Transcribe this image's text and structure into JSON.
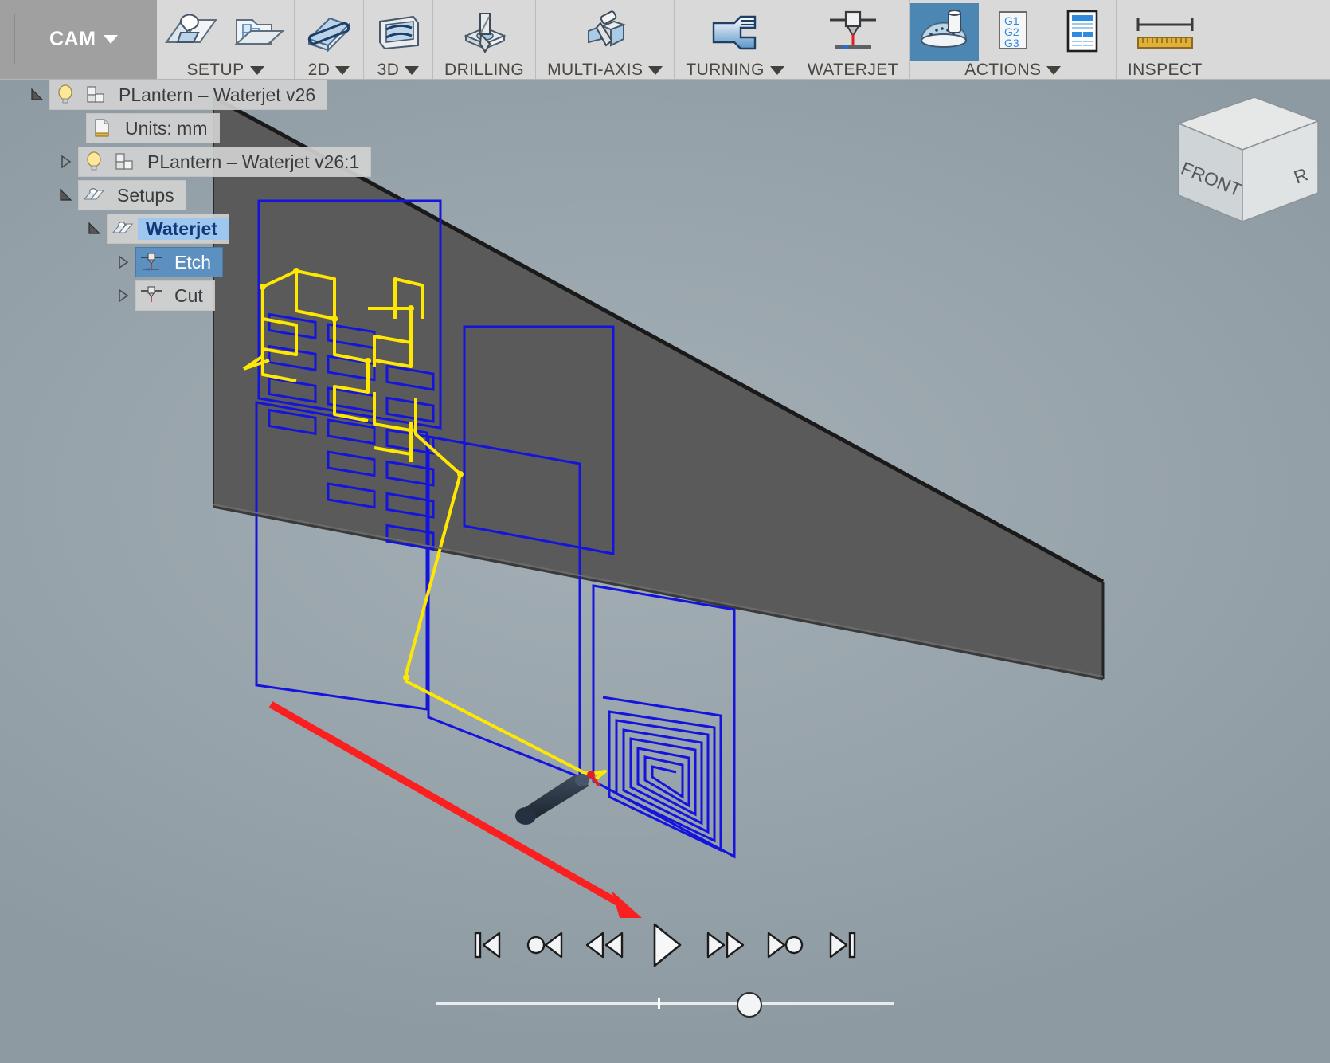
{
  "app": {
    "workspace_label": "CAM",
    "workspace_caret": "chevron-down-icon"
  },
  "ribbon": {
    "panels": [
      {
        "id": "setup",
        "label": "SETUP",
        "has_caret": true,
        "icons": [
          "new-setup-icon",
          "new-folder-icon"
        ]
      },
      {
        "id": "2d",
        "label": "2D",
        "has_caret": true,
        "icons": [
          "2d-milling-icon"
        ]
      },
      {
        "id": "3d",
        "label": "3D",
        "has_caret": true,
        "icons": [
          "3d-milling-icon"
        ]
      },
      {
        "id": "drilling",
        "label": "DRILLING",
        "has_caret": false,
        "icons": [
          "drilling-icon"
        ]
      },
      {
        "id": "multi-axis",
        "label": "MULTI-AXIS",
        "has_caret": true,
        "icons": [
          "multi-axis-icon"
        ]
      },
      {
        "id": "turning",
        "label": "TURNING",
        "has_caret": true,
        "icons": [
          "turning-icon"
        ]
      },
      {
        "id": "waterjet",
        "label": "WATERJET",
        "has_caret": false,
        "icons": [
          "waterjet-icon"
        ]
      },
      {
        "id": "actions",
        "label": "ACTIONS",
        "has_caret": true,
        "icons": [
          "simulate-icon",
          "post-process-icon",
          "setup-sheet-icon"
        ]
      },
      {
        "id": "inspect",
        "label": "INSPECT",
        "has_caret": false,
        "icons": [
          "measure-icon"
        ]
      }
    ],
    "active_button": "simulate-icon",
    "post_process_text": [
      "G1",
      "G2",
      "G3"
    ]
  },
  "browser": {
    "items": [
      {
        "label": "PLantern – Waterjet v26",
        "indent": 0,
        "toggle": "expanded",
        "icon": "lightbulb-icon",
        "icon2": "component-icon",
        "state": "normal"
      },
      {
        "label": "Units: mm",
        "indent": 1,
        "toggle": "none",
        "icon": "document-units-icon",
        "icon2": "",
        "state": "normal"
      },
      {
        "label": "PLantern – Waterjet v26:1",
        "indent": 1,
        "toggle": "collapsed",
        "icon": "lightbulb-icon",
        "icon2": "component-icon",
        "state": "normal"
      },
      {
        "label": "Setups",
        "indent": 1,
        "toggle": "expanded",
        "icon": "setup-folder-icon",
        "icon2": "",
        "state": "normal"
      },
      {
        "label": "Waterjet",
        "indent": 2,
        "toggle": "expanded",
        "icon": "setup-folder-icon",
        "icon2": "",
        "state": "selected-light"
      },
      {
        "label": "Etch",
        "indent": 3,
        "toggle": "collapsed",
        "icon": "waterjet-op-icon",
        "icon2": "",
        "state": "selected-dark"
      },
      {
        "label": "Cut",
        "indent": 3,
        "toggle": "collapsed",
        "icon": "waterjet-op-icon",
        "icon2": "",
        "state": "normal"
      }
    ]
  },
  "viewcube": {
    "front_face_label": "FRONT",
    "right_face_label": "R"
  },
  "simulation": {
    "controls": [
      {
        "id": "skip-to-start",
        "name": "skip-to-start-button",
        "glyph": "|<"
      },
      {
        "id": "step-backward",
        "name": "step-backward-button",
        "glyph": "o<"
      },
      {
        "id": "rewind",
        "name": "rewind-button",
        "glyph": "<<"
      },
      {
        "id": "play",
        "name": "play-button",
        "glyph": "|>"
      },
      {
        "id": "fast-forward",
        "name": "fast-forward-button",
        "glyph": ">>"
      },
      {
        "id": "step-forward",
        "name": "step-forward-button",
        "glyph": ">o"
      },
      {
        "id": "skip-to-end",
        "name": "skip-to-end-button",
        "glyph": ">|"
      }
    ],
    "timeline": {
      "position_percent": 68,
      "marker_percent": 48
    }
  },
  "colors": {
    "viewport_background": "#99a5ac",
    "stock_plate": "#59595a",
    "toolpath_cutting": "#1414dc",
    "toolpath_rapid": "#ffff00",
    "selection_highlight": "#5b90c0",
    "annotation_arrow": "#fa2020",
    "ribbon_background": "#d9d9d9",
    "workspace_block": "#a0a0a0"
  },
  "annotation": {
    "arrow_points_to": "play-button",
    "arrow_color": "#fa2020"
  }
}
